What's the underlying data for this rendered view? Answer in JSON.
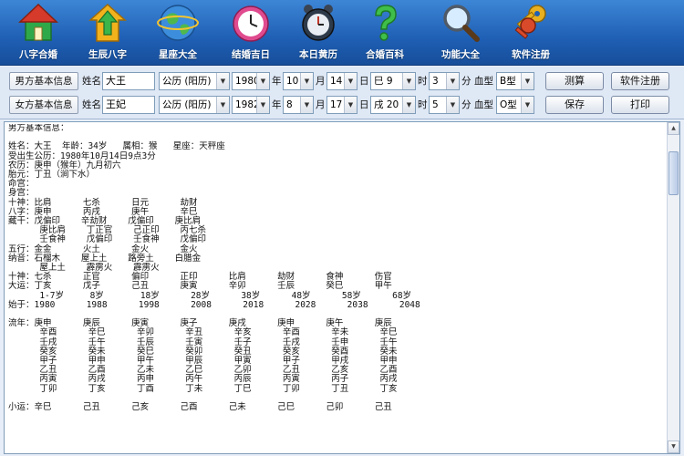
{
  "toolbar": {
    "items": [
      {
        "label": "八字合婚",
        "icon": "house-icon"
      },
      {
        "label": "生辰八字",
        "icon": "up-arrow-house-icon"
      },
      {
        "label": "星座大全",
        "icon": "globe-icon"
      },
      {
        "label": "结婚吉日",
        "icon": "clock-icon"
      },
      {
        "label": "本日黄历",
        "icon": "alarm-clock-icon"
      },
      {
        "label": "合婚百科",
        "icon": "question-mark-icon"
      },
      {
        "label": "功能大全",
        "icon": "magnifier-icon"
      },
      {
        "label": "软件注册",
        "icon": "keys-icon"
      }
    ]
  },
  "male": {
    "section_label": "男方基本信息",
    "name_label": "姓名",
    "name_value": "大王",
    "calendar": "公历 (阳历)",
    "year": "1980",
    "year_unit": "年",
    "month": "10",
    "month_unit": "月",
    "day": "14",
    "day_unit": "日",
    "hour": "巳 9",
    "hour_unit": "时",
    "minute": "3",
    "minute_unit": "分",
    "blood_label": "血型",
    "blood": "B型"
  },
  "female": {
    "section_label": "女方基本信息",
    "name_label": "姓名",
    "name_value": "王妃",
    "calendar": "公历 (阳历)",
    "year": "1982",
    "year_unit": "年",
    "month": "8",
    "month_unit": "月",
    "day": "17",
    "day_unit": "日",
    "hour": "戌 20",
    "hour_unit": "时",
    "minute": "5",
    "minute_unit": "分",
    "blood_label": "血型",
    "blood": "O型"
  },
  "buttons": {
    "calculate": "测算",
    "register": "软件注册",
    "save": "保存",
    "print": "打印"
  },
  "result_text": "男方基本信息：\n\n姓名：大王  年龄：34岁   属相：猴   星座：天秤座\n受出生公历：1980年10月14日9点3分\n农历：庚申（猴年）九月初六\n胎元：丁丑（涧下水）\n命宫：\n身宫：\n十神：比肩      七杀      日元      劫财\n八字：庚申      丙戌      庚午      辛巳\n藏干：戊偏印    辛劫财    戊偏印    庚比肩\n      庚比肩    丁正官    己正印    丙七杀\n      壬食神    戊偏印    壬食神    戊偏印\n五行：金金      火土      金火      金火\n纳音：石榴木    屋上土    路旁土    白腊金\n      屋上土    霹雳火    霹雳火\n十神：七杀      正官      偏印      正印      比肩      劫财      食神      伤官\n大运：丁亥      戊子      己丑      庚寅      辛卯      壬辰      癸巳      甲午\n      1-7岁     8岁       18岁      28岁      38岁      48岁      58岁      68岁\n始于：1980      1988      1998      2008      2018      2028      2038      2048\n\n流年：庚申      庚辰      庚寅      庚子      庚戌      庚申      庚午      庚辰\n      辛酉      辛巳      辛卯      辛丑      辛亥      辛酉      辛未      辛巳\n      壬戌      壬午      壬辰      壬寅      壬子      壬戌      壬申      壬午\n      癸亥      癸未      癸巳      癸卯      癸丑      癸亥      癸酉      癸未\n      甲子      甲申      甲午      甲辰      甲寅      甲子      甲戌      甲申\n      乙丑      乙酉      乙未      乙巳      乙卯      乙丑      乙亥      乙酉\n      丙寅      丙戌      丙申      丙午      丙辰      丙寅      丙子      丙戌\n      丁卯      丁亥      丁酉      丁未      丁巳      丁卯      丁丑      丁亥\n\n小运：辛巳      己丑      己亥      己酉      己未      己巳      己卯      己丑"
}
